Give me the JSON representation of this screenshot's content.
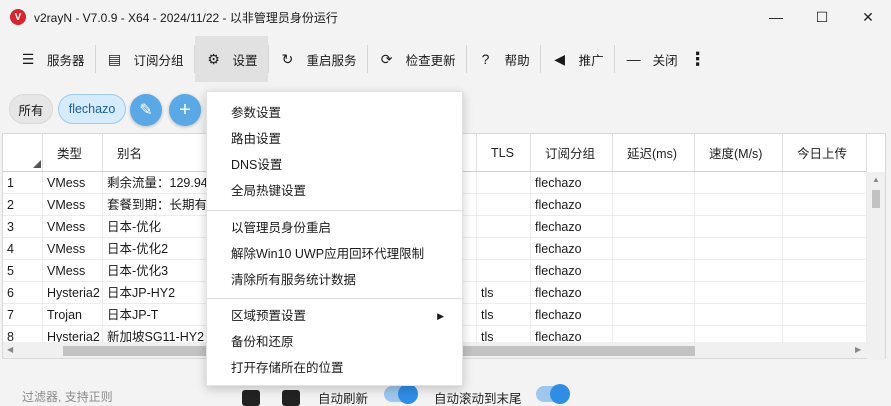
{
  "window": {
    "title": "v2rayN - V7.0.9 - X64 - 2024/11/22 - 以非管理员身份运行",
    "minimize": "—",
    "maximize": "☐",
    "close": "✕"
  },
  "toolbar": {
    "servers": "服务器",
    "sub_group": "订阅分组",
    "settings": "设置",
    "restart": "重启服务",
    "check_update": "检查更新",
    "help": "帮助",
    "promote": "推广",
    "close": "关闭",
    "more": "⋮"
  },
  "filters": {
    "all": "所有",
    "sub": "flechazo"
  },
  "table": {
    "headers": [
      "类型",
      "别名",
      "TLS",
      "订阅分组",
      "延迟(ms)",
      "速度(M/s)",
      "今日上传"
    ],
    "rows": [
      {
        "index": "1",
        "type": "VMess",
        "name": "剩余流量：129.94",
        "tls": "",
        "group": "flechazo"
      },
      {
        "index": "2",
        "type": "VMess",
        "name": "套餐到期：长期有效",
        "tls": "",
        "group": "flechazo"
      },
      {
        "index": "3",
        "type": "VMess",
        "name": "日本-优化",
        "tls": "",
        "group": "flechazo"
      },
      {
        "index": "4",
        "type": "VMess",
        "name": "日本-优化2",
        "tls": "",
        "group": "flechazo"
      },
      {
        "index": "5",
        "type": "VMess",
        "name": "日本-优化3",
        "tls": "",
        "group": "flechazo"
      },
      {
        "index": "6",
        "type": "Hysteria2",
        "name": "日本JP-HY2",
        "tls": "tls",
        "group": "flechazo"
      },
      {
        "index": "7",
        "type": "Trojan",
        "name": "日本JP-T",
        "tls": "tls",
        "group": "flechazo"
      },
      {
        "index": "8",
        "type": "Hysteria2",
        "name": "新加坡SG11-HY2",
        "tls": "tls",
        "group": "flechazo"
      }
    ]
  },
  "bottom": {
    "filter_placeholder": "过滤器, 支持正则",
    "auto_refresh": "自动刷新",
    "auto_scroll": "自动滚动到末尾"
  },
  "settings_menu": {
    "items": [
      "参数设置",
      "路由设置",
      "DNS设置",
      "全局热键设置",
      "以管理员身份重启",
      "解除Win10 UWP应用回环代理限制",
      "清除所有服务统计数据",
      "区域预置设置",
      "备份和还原",
      "打开存储所在的位置"
    ]
  },
  "colors": {
    "accent": "#5aa9e6",
    "toggle_on": "#2f8de4",
    "chip_selected_bg": "#d6ebfb",
    "app_icon": "#d7262e"
  }
}
